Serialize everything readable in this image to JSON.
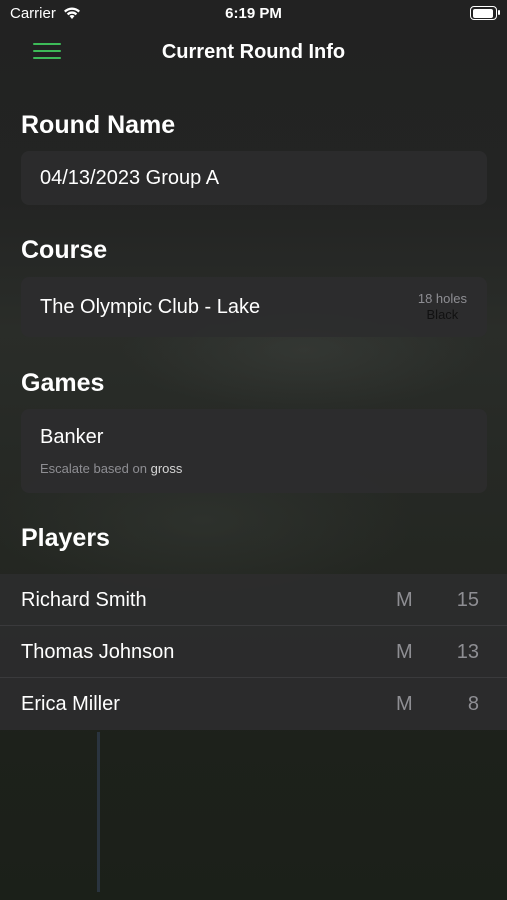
{
  "status_bar": {
    "carrier": "Carrier",
    "time": "6:19 PM"
  },
  "nav": {
    "title": "Current Round Info",
    "menu_icon": "hamburger-icon",
    "accent_color": "#3dbb58"
  },
  "round": {
    "label": "Round Name",
    "value": "04/13/2023 Group A"
  },
  "course": {
    "label": "Course",
    "name": "The Olympic Club - Lake",
    "holes": "18 holes",
    "tee": "Black"
  },
  "games": {
    "label": "Games",
    "items": [
      {
        "name": "Banker",
        "note_prefix": "Escalate based on",
        "note_value": "gross"
      }
    ]
  },
  "players": {
    "label": "Players",
    "rows": [
      {
        "name": "Richard Smith",
        "gender": "M",
        "handicap": "15"
      },
      {
        "name": "Thomas Johnson",
        "gender": "M",
        "handicap": "13"
      },
      {
        "name": "Erica Miller",
        "gender": "M",
        "handicap": "8"
      }
    ]
  }
}
